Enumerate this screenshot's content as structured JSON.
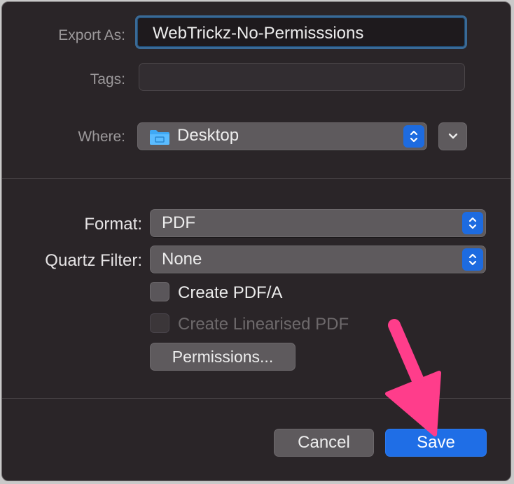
{
  "dialog": {
    "export_as_label": "Export As:",
    "export_as_value": "WebTrickz-No-Permisssions",
    "tags_label": "Tags:",
    "tags_value": "",
    "where_label": "Where:",
    "where_value": "Desktop"
  },
  "options": {
    "format_label": "Format:",
    "format_value": "PDF",
    "quartz_label": "Quartz Filter:",
    "quartz_value": "None",
    "create_pdfa_label": "Create PDF/A",
    "create_pdfa_checked": false,
    "linearised_label": "Create Linearised PDF",
    "linearised_enabled": false,
    "permissions_label": "Permissions..."
  },
  "footer": {
    "cancel_label": "Cancel",
    "save_label": "Save"
  },
  "colors": {
    "accent": "#1f6ee6",
    "arrow": "#ff3d8b",
    "background": "#2a2528"
  }
}
